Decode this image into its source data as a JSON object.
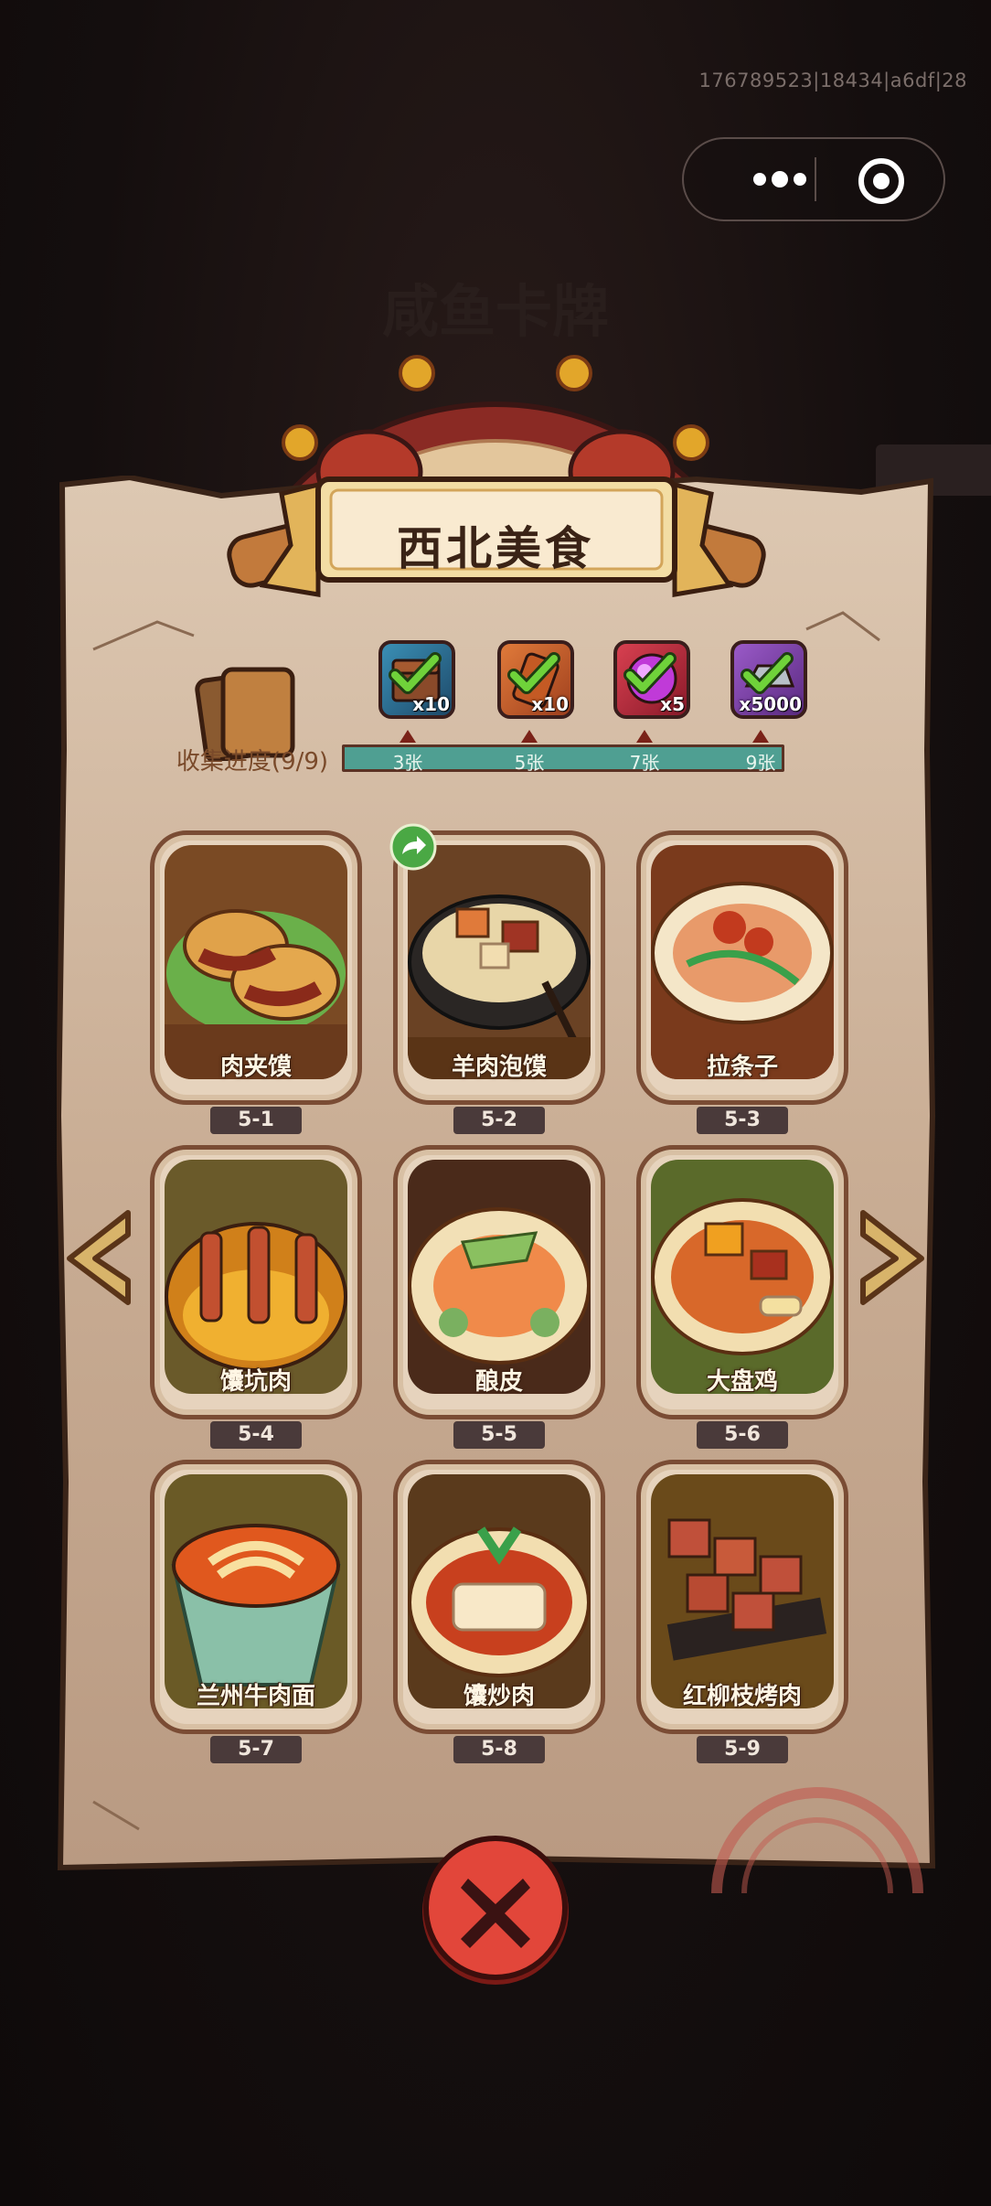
{
  "system": {
    "build_id": "176789523|18434|a6df|28"
  },
  "background": {
    "ghost_title": "咸鱼卡牌"
  },
  "header": {
    "title": "西北美食"
  },
  "collection": {
    "label": "收集进度(9/9)",
    "collected": 9,
    "total": 9
  },
  "rewards": [
    {
      "icon": "treasure-chest-icon",
      "qty": "x10",
      "threshold": "3张",
      "claimed": true,
      "color": "#2a6b8c"
    },
    {
      "icon": "scroll-ticket-icon",
      "qty": "x10",
      "threshold": "5张",
      "claimed": true,
      "color": "#b0532c"
    },
    {
      "icon": "purple-orb-icon",
      "qty": "x5",
      "threshold": "7张",
      "claimed": true,
      "color": "#b0283c"
    },
    {
      "icon": "silver-ingot-icon",
      "qty": "x5000",
      "threshold": "9张",
      "claimed": true,
      "color": "#7a3fa0"
    }
  ],
  "cards": [
    {
      "name": "肉夹馍",
      "code": "5-1"
    },
    {
      "name": "羊肉泡馍",
      "code": "5-2"
    },
    {
      "name": "拉条子",
      "code": "5-3"
    },
    {
      "name": "馕坑肉",
      "code": "5-4"
    },
    {
      "name": "酿皮",
      "code": "5-5"
    },
    {
      "name": "大盘鸡",
      "code": "5-6"
    },
    {
      "name": "兰州牛肉面",
      "code": "5-7"
    },
    {
      "name": "馕炒肉",
      "code": "5-8"
    },
    {
      "name": "红柳枝烤肉",
      "code": "5-9"
    }
  ],
  "colors": {
    "panel": "#cbb29a",
    "card_frame": "#7a4c34",
    "progress_bar": "#4f9f92",
    "close_button": "#e2463a",
    "check": "#6fd23a"
  }
}
